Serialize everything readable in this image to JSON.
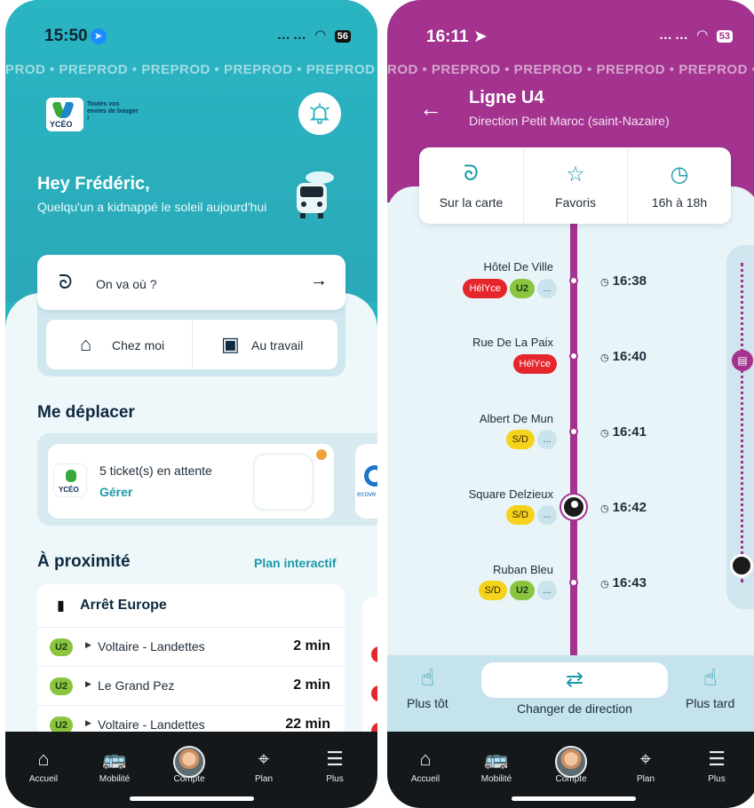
{
  "left": {
    "status": {
      "time": "15:50",
      "signal": "……",
      "battery": "56"
    },
    "watermark": "PROD • PREPROD • PREPROD • PREPROD • PREPROD • PREP",
    "logo_text": "YCÉO",
    "slogan": "Toutes vos envies de bouger !",
    "greeting": "Hey Frédéric,",
    "subtitle": "Quelqu'un a kidnappé le soleil aujourd'hui",
    "search_label": "On va où ?",
    "favorites": [
      {
        "icon": "home-icon",
        "label": "Chez moi"
      },
      {
        "icon": "briefcase-icon",
        "label": "Au travail"
      }
    ],
    "section_move": "Me déplacer",
    "ticket": {
      "text": "5 ticket(s) en attente",
      "action": "Gérer",
      "logo": "YCÉO"
    },
    "eco_text": "ecove",
    "section_near": "À proximité",
    "plan_link": "Plan interactif",
    "stop": {
      "name": "Arrêt Europe",
      "departures": [
        {
          "line": "U2",
          "dest": "Voltaire - Landettes",
          "time": "2 min"
        },
        {
          "line": "U2",
          "dest": "Le Grand Pez",
          "time": "2 min"
        },
        {
          "line": "U2",
          "dest": "Voltaire - Landettes",
          "time": "22 min"
        }
      ]
    }
  },
  "right": {
    "status": {
      "time": "16:11",
      "signal": "……",
      "battery": "53"
    },
    "watermark": "ROD • PREPROD • PREPROD • PREPROD • PREPROD • PREP",
    "line_title": "Ligne U4",
    "direction": "Direction Petit Maroc (saint-Nazaire)",
    "actions": [
      {
        "icon": "route-icon",
        "label": "Sur la carte"
      },
      {
        "icon": "star-icon",
        "label": "Favoris"
      },
      {
        "icon": "clock-icon",
        "label": "16h à 18h"
      }
    ],
    "stops": [
      {
        "name": "Hôtel De Ville",
        "badges": [
          {
            "t": "HélYce",
            "c": "red"
          },
          {
            "t": "U2",
            "c": "green"
          },
          {
            "t": "...",
            "c": "more"
          }
        ],
        "time": "16:38"
      },
      {
        "name": "Rue De La Paix",
        "badges": [
          {
            "t": "HélYce",
            "c": "red"
          }
        ],
        "time": "16:40"
      },
      {
        "name": "Albert De Mun",
        "badges": [
          {
            "t": "S/D",
            "c": "yellow"
          },
          {
            "t": "...",
            "c": "more"
          }
        ],
        "time": "16:41"
      },
      {
        "name": "Square Delzieux",
        "badges": [
          {
            "t": "S/D",
            "c": "yellow"
          },
          {
            "t": "...",
            "c": "more"
          }
        ],
        "time": "16:42"
      },
      {
        "name": "Ruban Bleu",
        "badges": [
          {
            "t": "S/D",
            "c": "yellow"
          },
          {
            "t": "U2",
            "c": "green"
          },
          {
            "t": "...",
            "c": "more"
          }
        ],
        "time": "16:43"
      }
    ],
    "earlier": "Plus tôt",
    "switch_dir": "Changer de direction",
    "later": "Plus tard"
  },
  "tabs": [
    {
      "icon": "home-icon",
      "label": "Accueil"
    },
    {
      "icon": "mobility-icon",
      "label": "Mobilité"
    },
    {
      "icon": "avatar",
      "label": "Compte"
    },
    {
      "icon": "map-icon",
      "label": "Plan"
    },
    {
      "icon": "menu-icon",
      "label": "Plus"
    }
  ],
  "colors": {
    "teal": "#2ab4c0",
    "purple": "#a3338f",
    "green_badge": "#8bc43f",
    "red_badge": "#e5262d",
    "yellow_badge": "#f5d21c"
  }
}
